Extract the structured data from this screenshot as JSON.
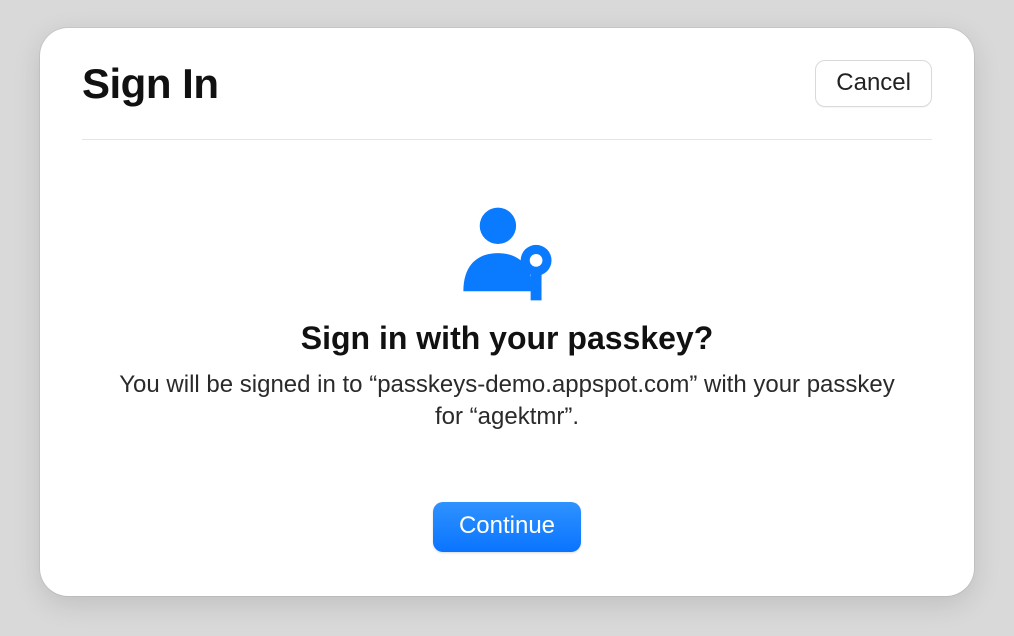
{
  "dialog": {
    "title": "Sign In",
    "cancel_label": "Cancel",
    "prompt_title": "Sign in with your passkey?",
    "prompt_subtitle": "You will be signed in to “passkeys-demo.appspot.com” with your passkey for “agektmr”.",
    "continue_label": "Continue",
    "accent_color": "#0a7aff"
  }
}
